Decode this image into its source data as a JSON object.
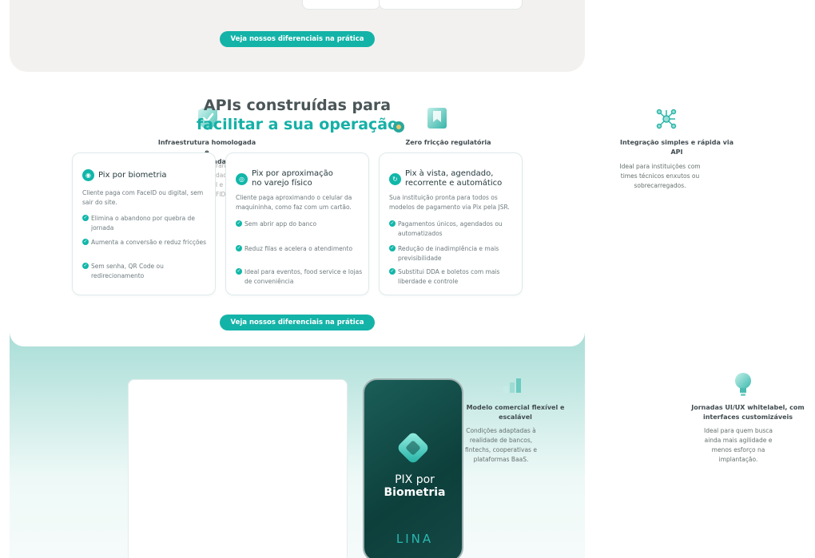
{
  "top_section": {
    "cta": "Veja nossos diferenciais na prática"
  },
  "headline": {
    "line1": "APIs construídas para",
    "line2": "facilitar a sua operação"
  },
  "features": [
    {
      "title_line1": "Infraestrutura homologada e",
      "title_line2": "certificada",
      "partial_desc": [
        "ran",
        "dad",
        "l e",
        "FID"
      ],
      "icon": "shield-icon"
    },
    {
      "title": "Zero fricção regulatória",
      "icon": "bookmark-doc-icon"
    },
    {
      "title_line1": "Integração simples e rápida via",
      "title_line2": "API",
      "desc": [
        "Ideal para instituições com",
        "times técnicos enxutos ou",
        "sobrecarregados."
      ],
      "icon": "network-icon"
    },
    {
      "title_line1": "Modelo comercial flexível e",
      "title_line2": "escalável",
      "desc": [
        "Condições adaptadas à",
        "realidade de bancos,",
        "fintechs, cooperativas e",
        "plataformas BaaS."
      ],
      "icon": "bar-chart-icon"
    },
    {
      "title_line1": "Jornadas UI/UX whitelabel, com",
      "title_line2": "interfaces customizáveis",
      "desc": [
        "Ideal para quem busca",
        "ainda mais agilidade e",
        "menos esforço na",
        "implantação."
      ],
      "icon": "lightbulb-icon"
    }
  ],
  "cards": [
    {
      "title": "Pix por biometria",
      "desc": "Cliente paga com FaceID ou digital, sem sair do site.",
      "bullets": [
        "Elimina o abandono por quebra de jornada",
        "Aumenta a conversão e reduz fricções",
        "Sem senha, QR Code ou redirecionamento"
      ],
      "icon": "fingerprint-icon"
    },
    {
      "title_line1": "Pix por aproximação",
      "title_line2": "no varejo físico",
      "desc": "Cliente paga aproximando o celular da maquininha, como faz com um cartão.",
      "bullets": [
        "Sem abrir app do banco",
        "Reduz filas e acelera o atendimento",
        "Ideal para eventos, food service e lojas de conveniência"
      ],
      "icon": "contactless-icon"
    },
    {
      "title_line1": "Pix à vista, agendado,",
      "title_line2": "recorrente e automático",
      "desc": "Sua instituição pronta para todos os modelos de pagamento via Pix pela JSR.",
      "bullets": [
        "Pagamentos únicos, agendados ou automatizados",
        "Redução de inadimplência e mais previsibilidade",
        "Substitui DDA e boletos com mais liberdade e controle"
      ],
      "icon": "refresh-icon"
    }
  ],
  "cta_bottom": "Veja nossos diferenciais na prática",
  "phone": {
    "line1": "PIX por",
    "line2": "Biometria",
    "brand": "LINA"
  },
  "colors": {
    "accent": "#14b3a8",
    "heading": "#4a5557",
    "mint_bg": "#a9ddd7"
  }
}
